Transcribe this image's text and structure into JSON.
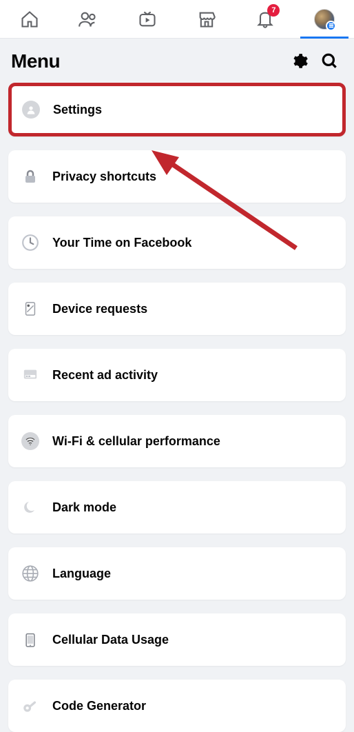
{
  "nav": {
    "notification_count": "7"
  },
  "header": {
    "title": "Menu"
  },
  "menu": {
    "items": [
      {
        "label": "Settings",
        "icon": "person-circle",
        "highlighted": true
      },
      {
        "label": "Privacy shortcuts",
        "icon": "lock"
      },
      {
        "label": "Your Time on Facebook",
        "icon": "clock"
      },
      {
        "label": "Device requests",
        "icon": "device-request"
      },
      {
        "label": "Recent ad activity",
        "icon": "ad"
      },
      {
        "label": "Wi-Fi & cellular performance",
        "icon": "wifi"
      },
      {
        "label": "Dark mode",
        "icon": "moon"
      },
      {
        "label": "Language",
        "icon": "globe"
      },
      {
        "label": "Cellular Data Usage",
        "icon": "phone"
      },
      {
        "label": "Code Generator",
        "icon": "key"
      }
    ]
  },
  "annotation": {
    "highlight_color": "#c1272d"
  }
}
